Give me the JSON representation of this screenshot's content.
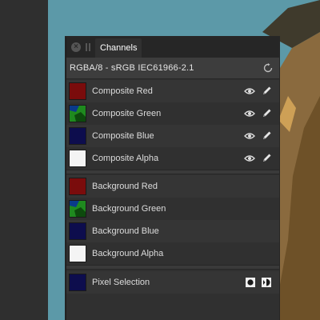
{
  "panel": {
    "tab_label": "Channels",
    "colorspace": "RGBA/8 - sRGB IEC61966-2.1"
  },
  "composite_channels": [
    {
      "label": "Composite Red",
      "swatch": "red-thumbnail",
      "color": "#7a0c0c"
    },
    {
      "label": "Composite Green",
      "swatch": "green-thumbnail",
      "color": "#1f8a1f"
    },
    {
      "label": "Composite Blue",
      "swatch": "blue-thumbnail",
      "color": "#0d0d4d"
    },
    {
      "label": "Composite Alpha",
      "swatch": "alpha-thumbnail",
      "color": "#f4f4f4"
    }
  ],
  "background_channels": [
    {
      "label": "Background Red",
      "swatch": "red-thumbnail",
      "color": "#7a0c0c"
    },
    {
      "label": "Background Green",
      "swatch": "green-thumbnail",
      "color": "#1f8a1f"
    },
    {
      "label": "Background Blue",
      "swatch": "blue-thumbnail",
      "color": "#0d0d4d"
    },
    {
      "label": "Background Alpha",
      "swatch": "alpha-thumbnail",
      "color": "#f4f4f4"
    }
  ],
  "selection": {
    "label": "Pixel Selection",
    "swatch": "selection-thumbnail",
    "color": "#0d0d4d"
  },
  "icons": {
    "close": "close-icon",
    "grip": "grip-icon",
    "reset": "reset-icon",
    "visibility": "eye-icon",
    "edit": "pencil-icon",
    "selection_a": "fill-selection-icon",
    "selection_b": "invert-selection-icon"
  },
  "colors": {
    "canvas": "#5c99a8",
    "panel": "#303030",
    "titlebar": "#262626",
    "text": "#dcdcdc"
  }
}
